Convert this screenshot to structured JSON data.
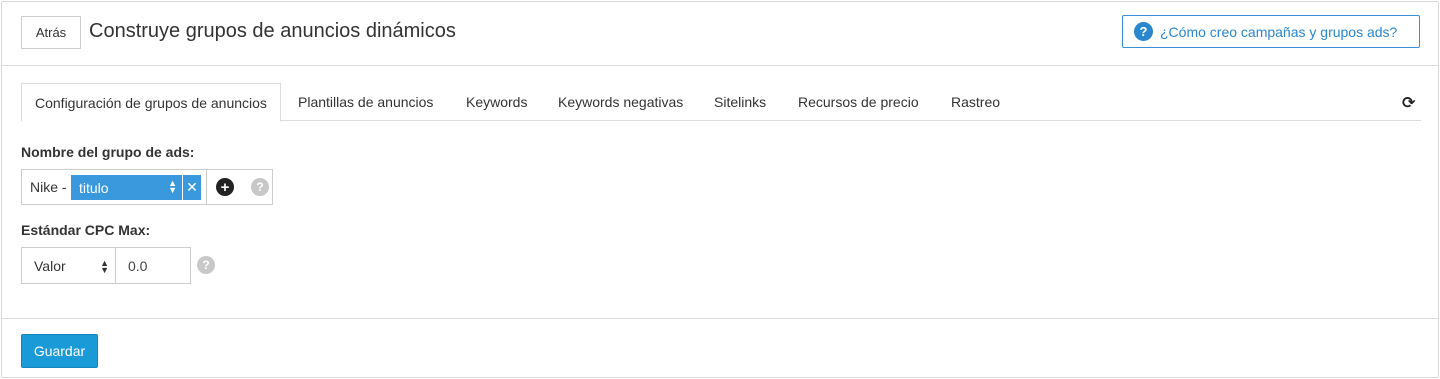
{
  "header": {
    "back_label": "Atrás",
    "title": "Construye grupos de anuncios dinámicos",
    "help_label": "¿Cómo creo campañas y grupos ads?",
    "help_icon": "question-circle-icon"
  },
  "tabs": [
    {
      "label": "Configuración de grupos de anuncios",
      "active": true
    },
    {
      "label": "Plantillas de anuncios"
    },
    {
      "label": "Keywords"
    },
    {
      "label": "Keywords negativas"
    },
    {
      "label": "Sitelinks"
    },
    {
      "label": "Recursos de precio"
    },
    {
      "label": "Rastreo"
    }
  ],
  "form": {
    "name_label": "Nombre del grupo de ads:",
    "name_prefix": "Nike -",
    "name_variable": "titulo",
    "cpc_label": "Estándar CPC Max:",
    "cpc_mode": "Valor",
    "cpc_value": "0.0"
  },
  "footer": {
    "save_label": "Guardar"
  },
  "colors": {
    "accent": "#1a9ad6",
    "variable_chip": "#3a98dc",
    "help_link": "#2a86cf"
  }
}
